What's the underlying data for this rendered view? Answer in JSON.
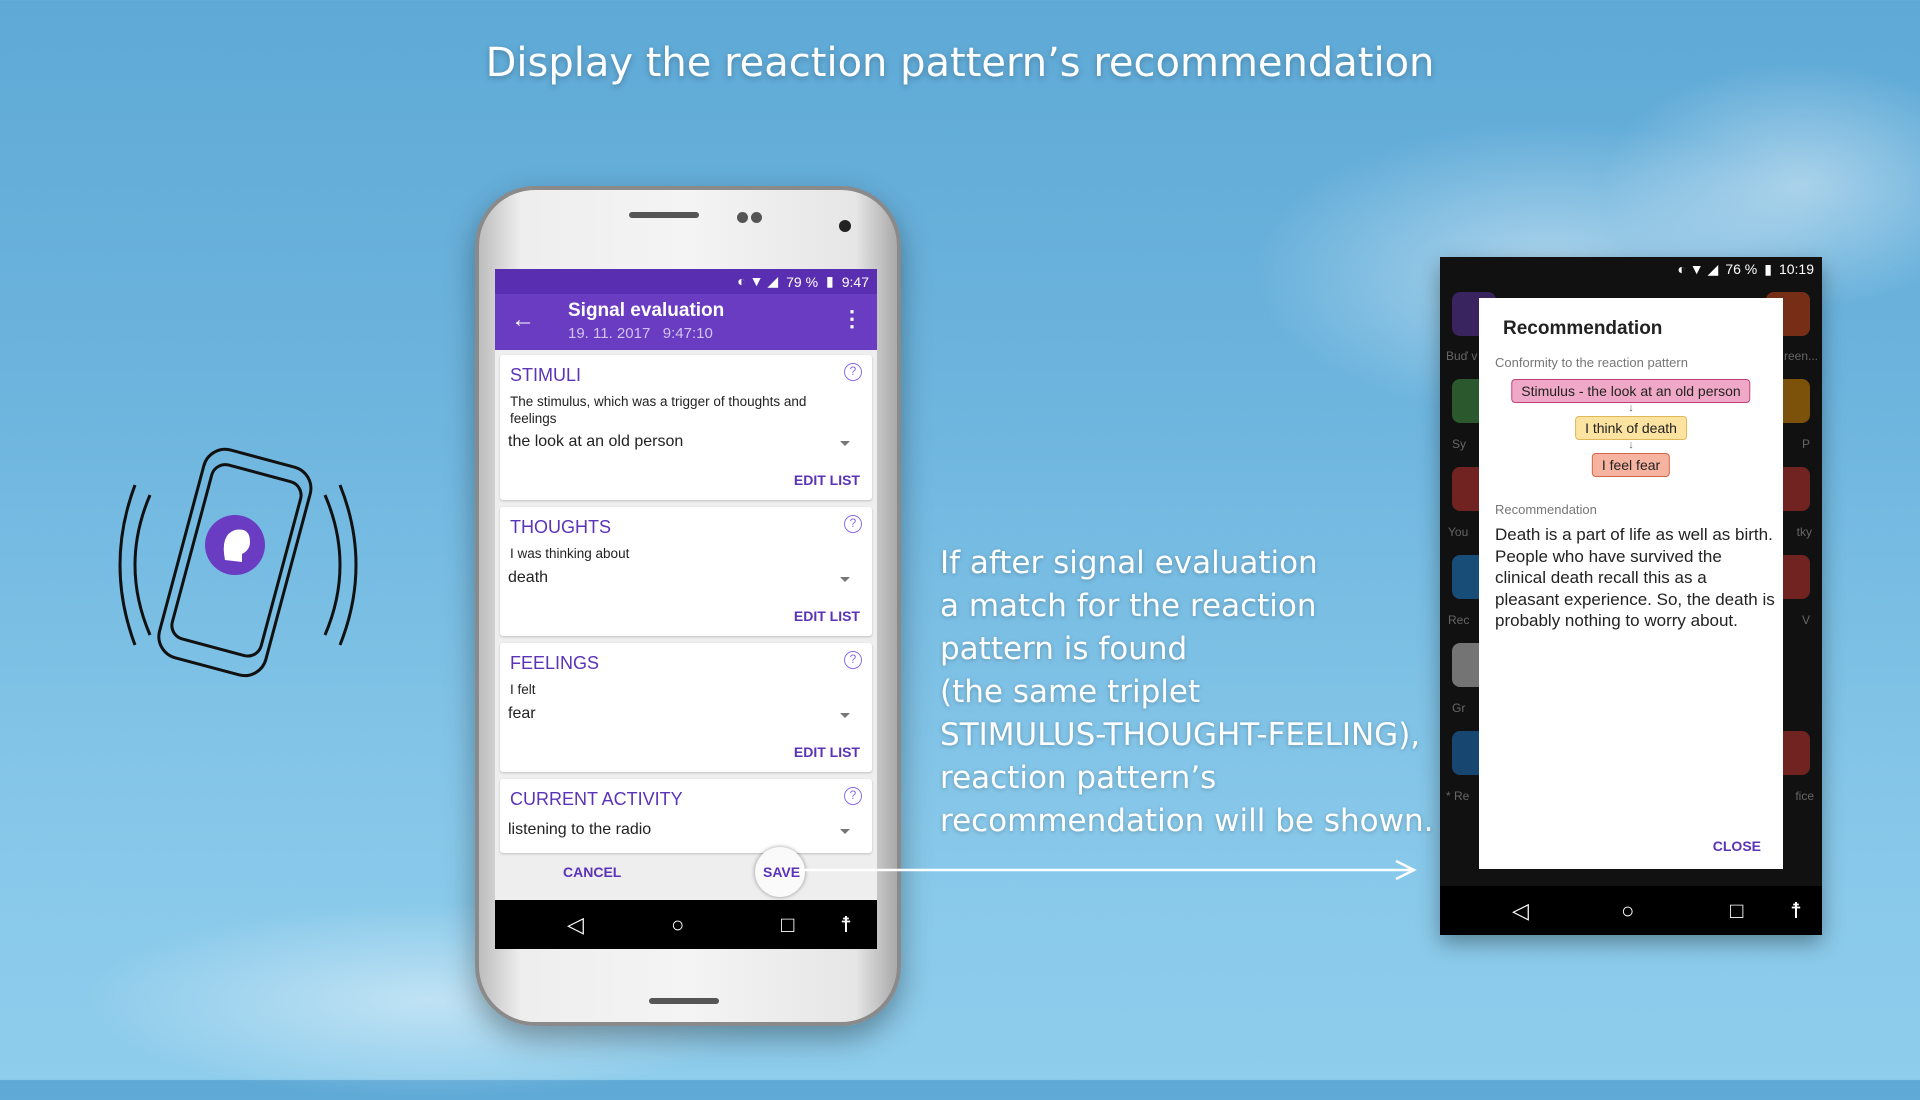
{
  "heading": "Display the reaction pattern’s recommendation",
  "explanation": [
    "If after signal evaluation",
    "a match for the reaction",
    "pattern is found",
    "(the same triplet",
    "STIMULUS-THOUGHT-FEELING),",
    "reaction pattern’s",
    "recommendation will be shown."
  ],
  "left_phone": {
    "status": {
      "battery": "79 %",
      "time": "9:47"
    },
    "appbar": {
      "title": "Signal evaluation",
      "subtitle": "19. 11. 2017   9:47:10"
    },
    "cards": [
      {
        "title": "STIMULI",
        "description": "The stimulus, which was a trigger of thoughts and feelings",
        "value": "the look at an old person",
        "edit": "EDIT LIST"
      },
      {
        "title": "THOUGHTS",
        "description": "I was thinking about",
        "value": "death",
        "edit": "EDIT LIST"
      },
      {
        "title": "FEELINGS",
        "description": "I felt",
        "value": "fear",
        "edit": "EDIT LIST"
      },
      {
        "title": "CURRENT ACTIVITY",
        "value": "listening to the radio"
      }
    ],
    "cancel": "CANCEL",
    "save": "SAVE",
    "help": "?"
  },
  "right_phone": {
    "status": {
      "battery": "76 %",
      "time": "10:19"
    },
    "bg_labels": [
      "Buď v",
      "reen...",
      "Sy",
      "P",
      "You",
      "tky",
      "Rec",
      "V",
      "Gr",
      "* Re",
      "fice"
    ],
    "dialog": {
      "title": "Recommendation",
      "conformity_label": "Conformity to the reaction pattern",
      "chain": [
        "Stimulus - the look at an old person",
        "I think of death",
        "I feel fear"
      ],
      "recommendation_label": "Recommendation",
      "recommendation": "Death is a part of life as well as birth. People who have survived the clinical death recall this as a pleasant experience. So, the death is probably nothing to worry about.",
      "close": "CLOSE"
    }
  },
  "colors": {
    "accent": "#6a3cc2",
    "stimulus_chip": "#f0a8c8",
    "thought_chip": "#fde3a0",
    "feeling_chip": "#f6b3a0"
  }
}
